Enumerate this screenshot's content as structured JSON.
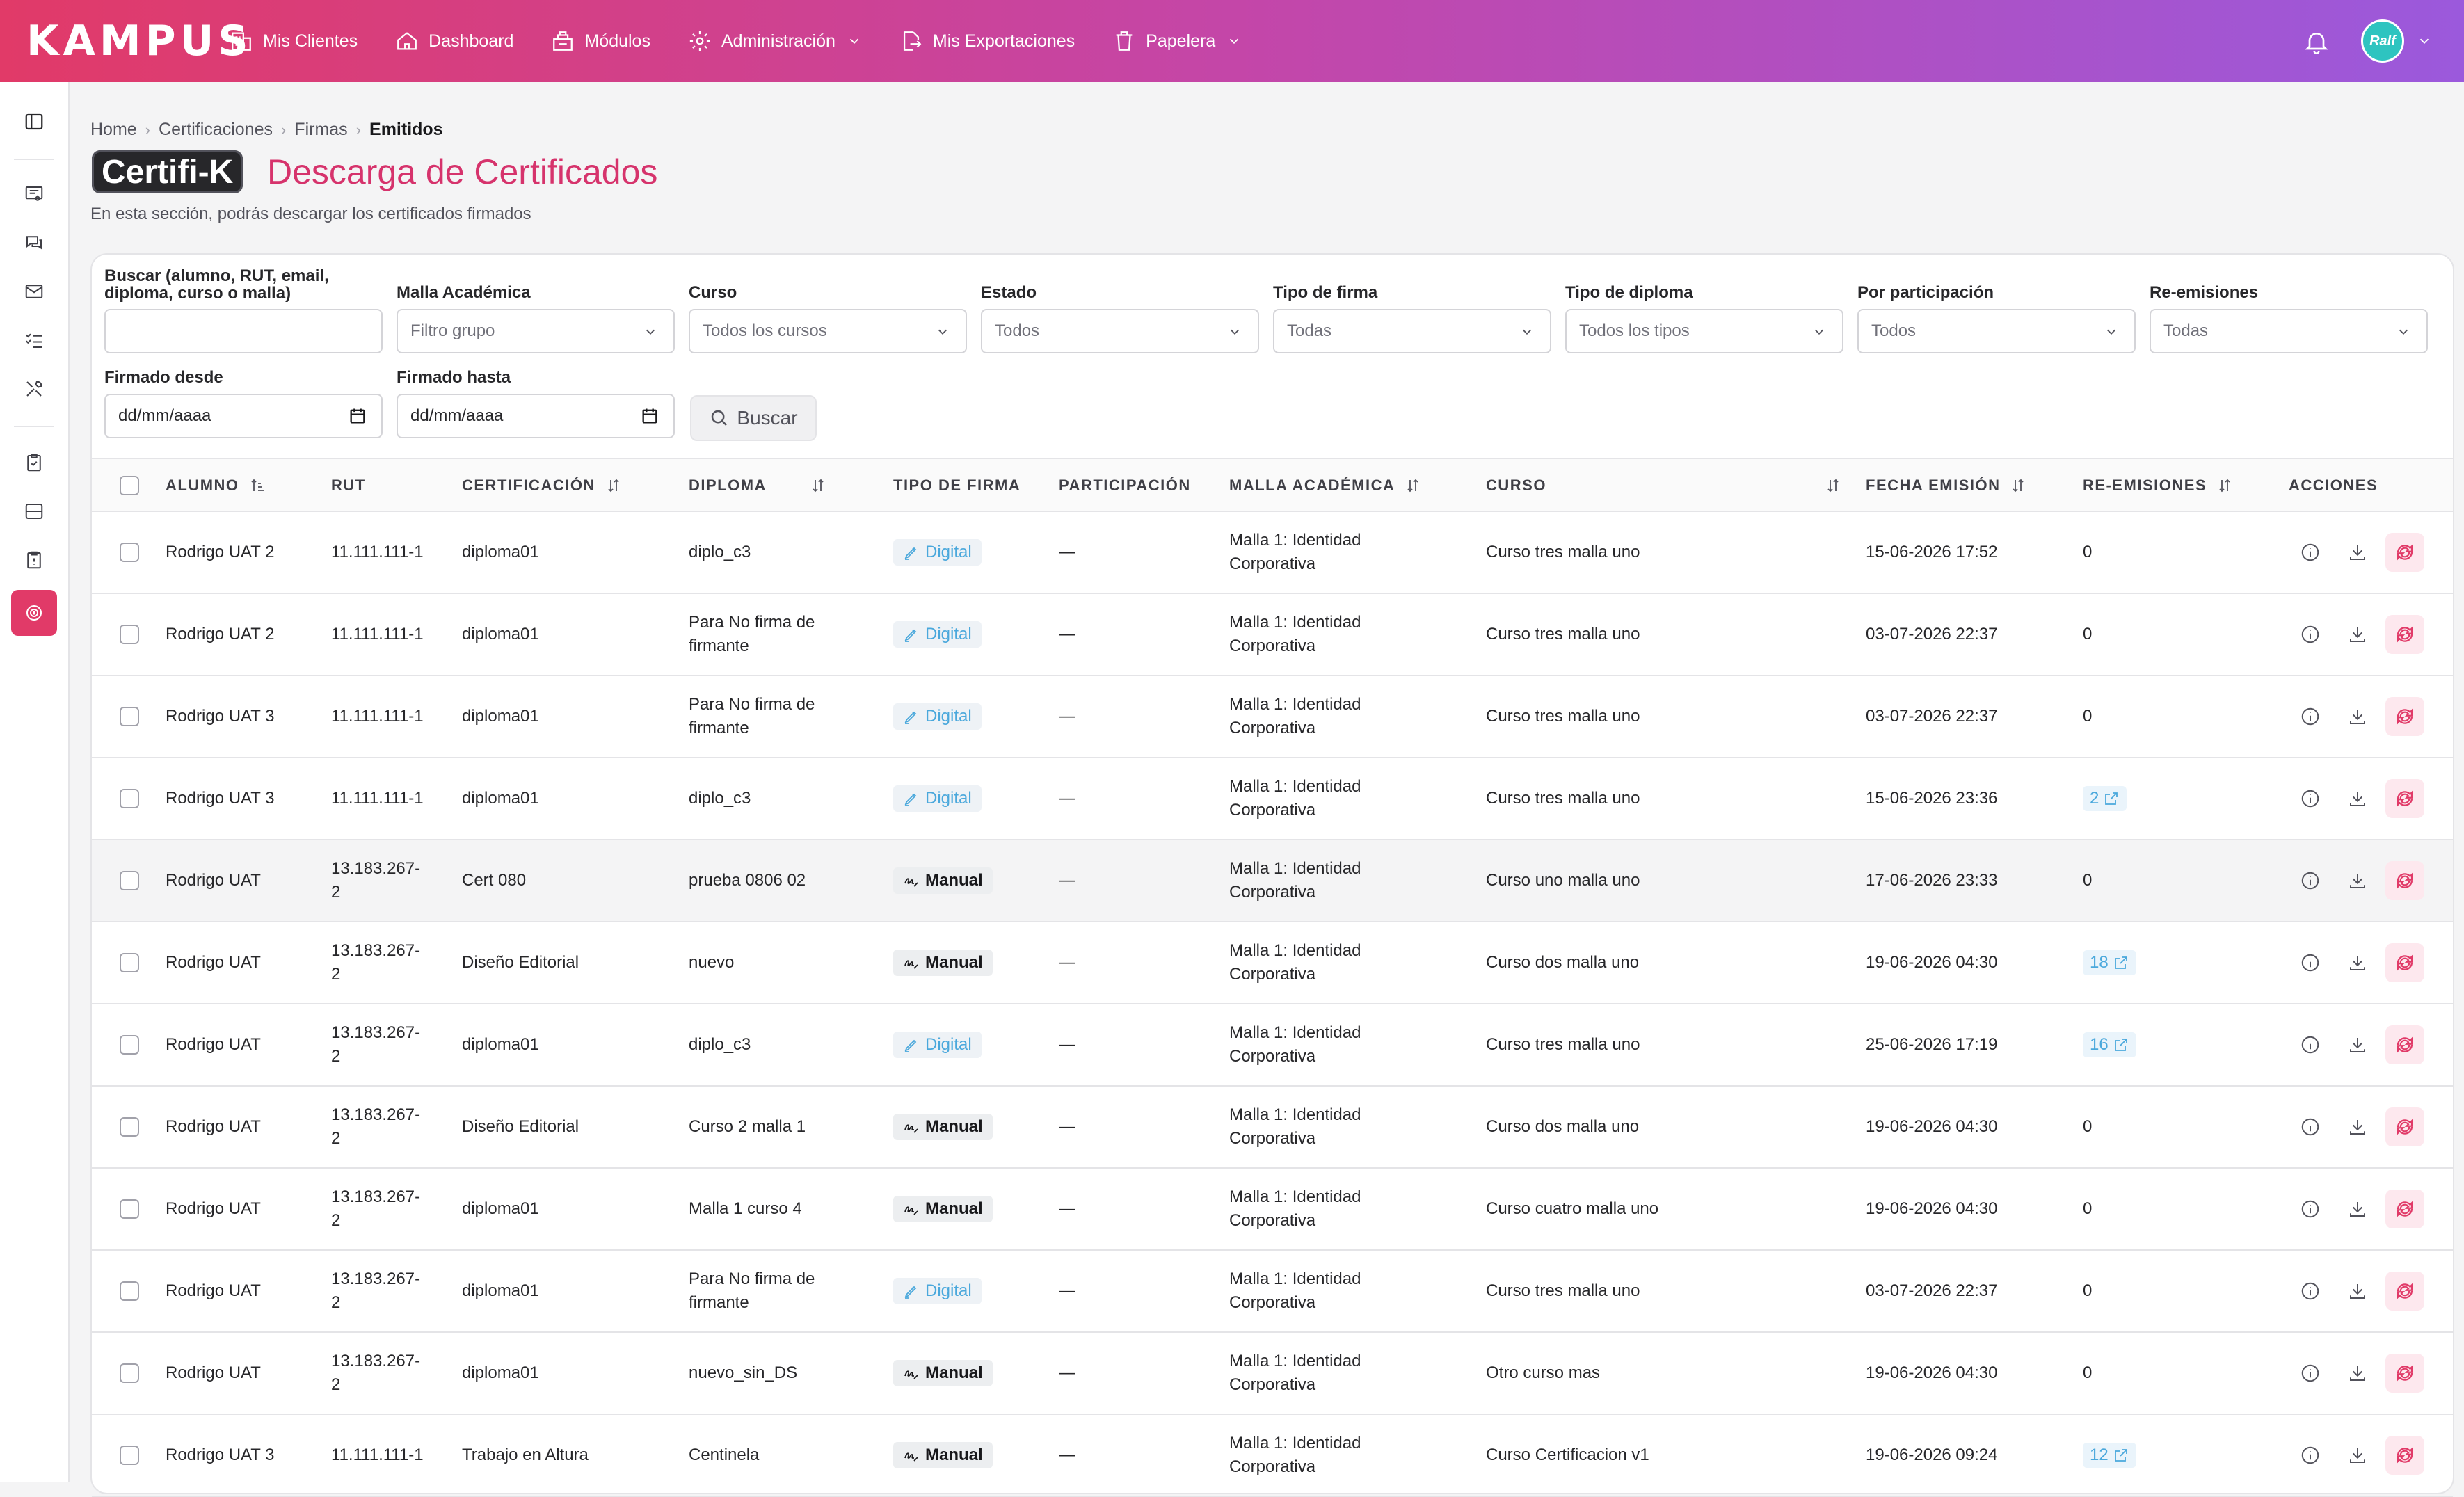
{
  "app": {
    "logo": "KAMPUS",
    "nav": [
      {
        "label": "Mis Clientes",
        "icon": "building-icon"
      },
      {
        "label": "Dashboard",
        "icon": "home-icon"
      },
      {
        "label": "Módulos",
        "icon": "modules-icon"
      },
      {
        "label": "Administración",
        "icon": "gear-icon",
        "dropdown": true
      },
      {
        "label": "Mis Exportaciones",
        "icon": "export-icon"
      },
      {
        "label": "Papelera",
        "icon": "trash-icon",
        "dropdown": true
      }
    ],
    "avatar_text": "Ralf",
    "colors": {
      "gradient_start": "#e13a68",
      "gradient_end": "#9b59dc",
      "accent": "#d6336c",
      "digital": "#4aa8dc"
    }
  },
  "breadcrumb": [
    "Home",
    "Certificaciones",
    "Firmas",
    "Emitidos"
  ],
  "header": {
    "brand_badge": "Certifi-K",
    "title": "Descarga de Certificados",
    "subtitle": "En esta sección, podrás descargar los certificados firmados"
  },
  "filters": {
    "search_label": "Buscar (alumno, RUT, email, diploma, curso o malla)",
    "search_value": "",
    "malla_label": "Malla Académica",
    "malla_value": "Filtro grupo",
    "curso_label": "Curso",
    "curso_value": "Todos los cursos",
    "estado_label": "Estado",
    "estado_value": "Todos",
    "tipo_firma_label": "Tipo de firma",
    "tipo_firma_value": "Todas",
    "tipo_diploma_label": "Tipo de diploma",
    "tipo_diploma_value": "Todos los tipos",
    "participacion_label": "Por participación",
    "participacion_value": "Todos",
    "reemisiones_label": "Re-emisiones",
    "reemisiones_value": "Todas",
    "desde_label": "Firmado desde",
    "desde_value": "dd/mm/aaaa",
    "hasta_label": "Firmado hasta",
    "hasta_value": "dd/mm/aaaa",
    "search_button": "Buscar"
  },
  "table": {
    "headers": {
      "alumno": "ALUMNO",
      "rut": "RUT",
      "certificacion": "CERTIFICACIÓN",
      "diploma": "DIPLOMA",
      "tipo_firma": "TIPO DE FIRMA",
      "participacion": "PARTICIPACIÓN",
      "malla": "MALLA ACADÉMICA",
      "curso": "CURSO",
      "fecha": "FECHA EMISIÓN",
      "reemisiones": "RE-EMISIONES",
      "acciones": "ACCIONES"
    },
    "rows": [
      {
        "alumno": "Rodrigo UAT 2",
        "rut": "11.111.111-1",
        "certificacion": "diploma01",
        "diploma": "diplo_c3",
        "tipo_firma": "Digital",
        "participacion": "—",
        "malla": "Malla 1: Identidad Corporativa",
        "curso": "Curso tres malla uno",
        "fecha": "15-06-2026 17:52",
        "reemisiones": "0",
        "reem_link": false
      },
      {
        "alumno": "Rodrigo UAT 2",
        "rut": "11.111.111-1",
        "certificacion": "diploma01",
        "diploma": "Para No firma de firmante",
        "tipo_firma": "Digital",
        "participacion": "—",
        "malla": "Malla 1: Identidad Corporativa",
        "curso": "Curso tres malla uno",
        "fecha": "03-07-2026 22:37",
        "reemisiones": "0",
        "reem_link": false
      },
      {
        "alumno": "Rodrigo UAT 3",
        "rut": "11.111.111-1",
        "certificacion": "diploma01",
        "diploma": "Para No firma de firmante",
        "tipo_firma": "Digital",
        "participacion": "—",
        "malla": "Malla 1: Identidad Corporativa",
        "curso": "Curso tres malla uno",
        "fecha": "03-07-2026 22:37",
        "reemisiones": "0",
        "reem_link": false
      },
      {
        "alumno": "Rodrigo UAT 3",
        "rut": "11.111.111-1",
        "certificacion": "diploma01",
        "diploma": "diplo_c3",
        "tipo_firma": "Digital",
        "participacion": "—",
        "malla": "Malla 1: Identidad Corporativa",
        "curso": "Curso tres malla uno",
        "fecha": "15-06-2026 23:36",
        "reemisiones": "2",
        "reem_link": true
      },
      {
        "alumno": "Rodrigo UAT",
        "rut": "13.183.267-2",
        "certificacion": "Cert 080",
        "diploma": "prueba 0806 02",
        "tipo_firma": "Manual",
        "participacion": "—",
        "malla": "Malla 1: Identidad Corporativa",
        "curso": "Curso uno malla uno",
        "fecha": "17-06-2026 23:33",
        "reemisiones": "0",
        "reem_link": false
      },
      {
        "alumno": "Rodrigo UAT",
        "rut": "13.183.267-2",
        "certificacion": "Diseño Editorial",
        "diploma": "nuevo",
        "tipo_firma": "Manual",
        "participacion": "—",
        "malla": "Malla 1: Identidad Corporativa",
        "curso": "Curso dos malla uno",
        "fecha": "19-06-2026 04:30",
        "reemisiones": "18",
        "reem_link": true
      },
      {
        "alumno": "Rodrigo UAT",
        "rut": "13.183.267-2",
        "certificacion": "diploma01",
        "diploma": "diplo_c3",
        "tipo_firma": "Digital",
        "participacion": "—",
        "malla": "Malla 1: Identidad Corporativa",
        "curso": "Curso tres malla uno",
        "fecha": "25-06-2026 17:19",
        "reemisiones": "16",
        "reem_link": true
      },
      {
        "alumno": "Rodrigo UAT",
        "rut": "13.183.267-2",
        "certificacion": "Diseño Editorial",
        "diploma": "Curso 2 malla 1",
        "tipo_firma": "Manual",
        "participacion": "—",
        "malla": "Malla 1: Identidad Corporativa",
        "curso": "Curso dos malla uno",
        "fecha": "19-06-2026 04:30",
        "reemisiones": "0",
        "reem_link": false
      },
      {
        "alumno": "Rodrigo UAT",
        "rut": "13.183.267-2",
        "certificacion": "diploma01",
        "diploma": "Malla 1 curso 4",
        "tipo_firma": "Manual",
        "participacion": "—",
        "malla": "Malla 1: Identidad Corporativa",
        "curso": "Curso cuatro malla uno",
        "fecha": "19-06-2026 04:30",
        "reemisiones": "0",
        "reem_link": false
      },
      {
        "alumno": "Rodrigo UAT",
        "rut": "13.183.267-2",
        "certificacion": "diploma01",
        "diploma": "Para No firma de firmante",
        "tipo_firma": "Digital",
        "participacion": "—",
        "malla": "Malla 1: Identidad Corporativa",
        "curso": "Curso tres malla uno",
        "fecha": "03-07-2026 22:37",
        "reemisiones": "0",
        "reem_link": false
      },
      {
        "alumno": "Rodrigo UAT",
        "rut": "13.183.267-2",
        "certificacion": "diploma01",
        "diploma": "nuevo_sin_DS",
        "tipo_firma": "Manual",
        "participacion": "—",
        "malla": "Malla 1: Identidad Corporativa",
        "curso": "Otro curso mas",
        "fecha": "19-06-2026 04:30",
        "reemisiones": "0",
        "reem_link": false
      },
      {
        "alumno": "Rodrigo UAT 3",
        "rut": "11.111.111-1",
        "certificacion": "Trabajo en Altura",
        "diploma": "Centinela",
        "tipo_firma": "Manual",
        "participacion": "—",
        "malla": "Malla 1: Identidad Corporativa",
        "curso": "Curso Certificacion v1",
        "fecha": "19-06-2026 09:24",
        "reemisiones": "12",
        "reem_link": true
      }
    ]
  }
}
